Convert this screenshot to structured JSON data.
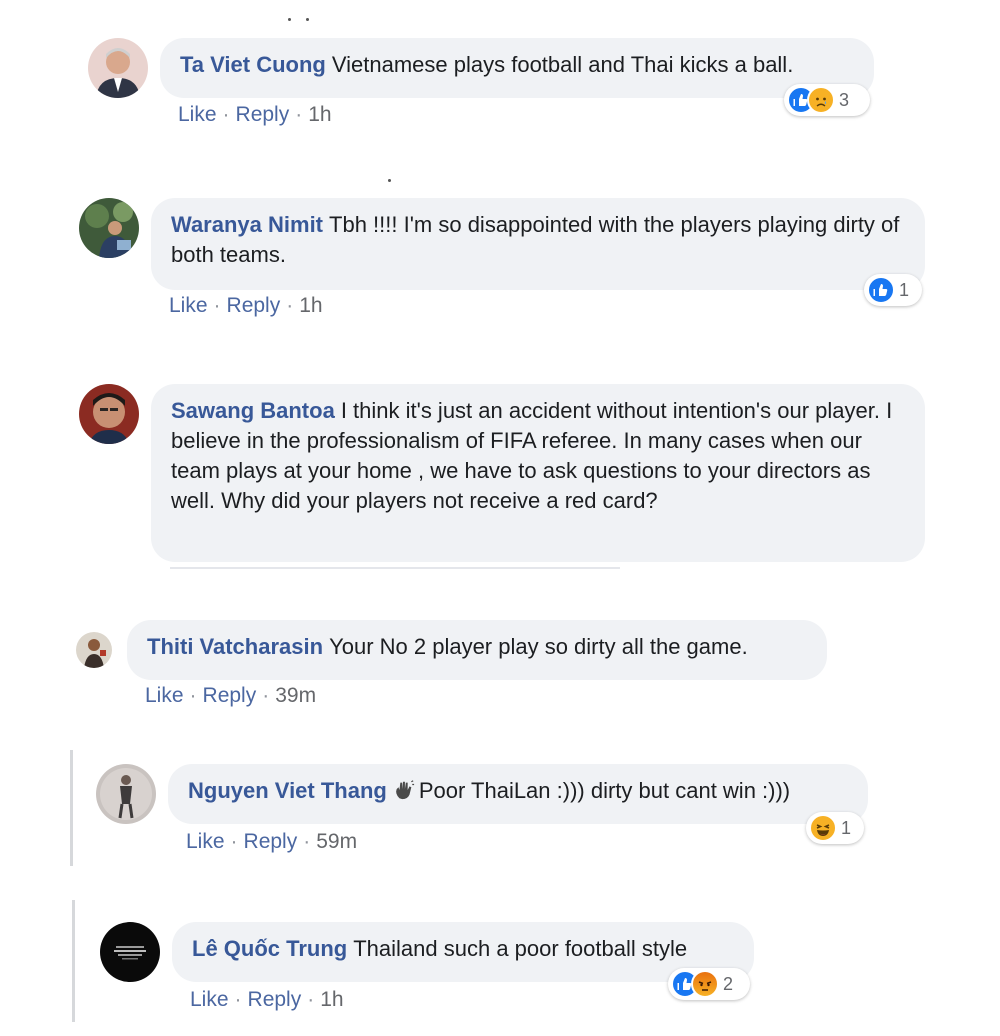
{
  "labels": {
    "like": "Like",
    "reply": "Reply",
    "separator": "·"
  },
  "comments": [
    {
      "author": "Ta Viet Cuong",
      "text": "Vietnamese plays football and Thai kicks a ball.",
      "time": "1h",
      "reactions": [
        "like-icon",
        "sad-icon"
      ],
      "reaction_count": "3"
    },
    {
      "author": "Waranya Nimit",
      "text": "Tbh !!!! I'm so disappointed with the players playing dirty of both teams.",
      "time": "1h",
      "reactions": [
        "like-icon"
      ],
      "reaction_count": "1"
    },
    {
      "author": "Sawang Bantoa",
      "text": "I think it's just an accident without intention's our player. I believe in the professionalism of FIFA referee. In many cases when our team plays at your home , we have to ask questions to your directors as well. Why did your players not receive a red card?"
    },
    {
      "author": "Thiti Vatcharasin",
      "text": "Your No 2 player play so dirty all the game.",
      "time": "39m"
    },
    {
      "author": "Nguyen Viet Thang",
      "badge": "waving-hand-icon",
      "text": "Poor ThaiLan :))) dirty but cant win :)))",
      "time": "59m",
      "reactions": [
        "haha-icon"
      ],
      "reaction_count": "1"
    },
    {
      "author": "Lê Quốc Trung",
      "text": "Thailand such a poor football style",
      "time": "1h",
      "reactions": [
        "like-icon",
        "angry-icon"
      ],
      "reaction_count": "2"
    }
  ],
  "colors": {
    "link_blue": "#385898",
    "bubble_bg": "#f0f2f5",
    "like_blue": "#1877f2",
    "emoji_yellow": "#f7b125"
  }
}
